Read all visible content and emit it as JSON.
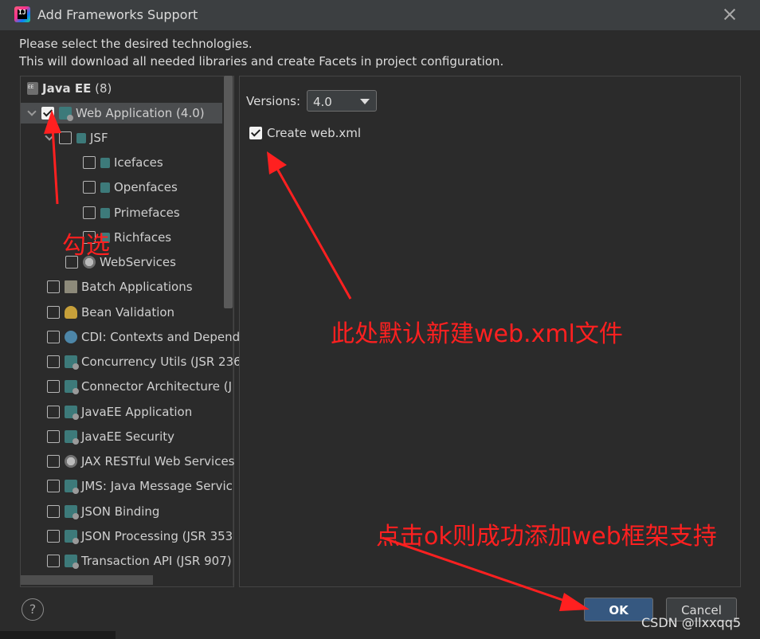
{
  "window": {
    "title": "Add Frameworks Support",
    "app_icon_text": "IJ",
    "description_line1": "Please select the desired technologies.",
    "description_line2": "This will download all needed libraries and create Facets in project configuration."
  },
  "tree": {
    "group_label": "Java EE",
    "group_count": "(8)",
    "items": [
      {
        "label": "Web Application (4.0)",
        "checked": true,
        "icon": "web-app-icon"
      },
      {
        "label": "JSF",
        "checked": false,
        "icon": "jsf-icon"
      },
      {
        "label": "Icefaces",
        "checked": false,
        "icon": "jsf-icon"
      },
      {
        "label": "Openfaces",
        "checked": false,
        "icon": "jsf-icon"
      },
      {
        "label": "Primefaces",
        "checked": false,
        "icon": "jsf-icon"
      },
      {
        "label": "Richfaces",
        "checked": false,
        "icon": "jsf-icon"
      },
      {
        "label": "WebServices",
        "checked": false,
        "icon": "globe-icon"
      },
      {
        "label": "Batch Applications",
        "checked": false,
        "icon": "folder-icon"
      },
      {
        "label": "Bean Validation",
        "checked": false,
        "icon": "bean-icon"
      },
      {
        "label": "CDI: Contexts and Depend",
        "checked": false,
        "icon": "cdi-icon"
      },
      {
        "label": "Concurrency Utils (JSR 236",
        "checked": false,
        "icon": "web-app-icon"
      },
      {
        "label": "Connector Architecture (J",
        "checked": false,
        "icon": "web-app-icon"
      },
      {
        "label": "JavaEE Application",
        "checked": false,
        "icon": "web-app-icon"
      },
      {
        "label": "JavaEE Security",
        "checked": false,
        "icon": "web-app-icon"
      },
      {
        "label": "JAX RESTful Web Services",
        "checked": false,
        "icon": "globe-icon"
      },
      {
        "label": "JMS: Java Message Servic",
        "checked": false,
        "icon": "web-app-icon"
      },
      {
        "label": "JSON Binding",
        "checked": false,
        "icon": "web-app-icon"
      },
      {
        "label": "JSON Processing (JSR 353",
        "checked": false,
        "icon": "web-app-icon"
      },
      {
        "label": "Transaction API (JSR 907)",
        "checked": false,
        "icon": "web-app-icon"
      }
    ]
  },
  "settings": {
    "versions_label": "Versions:",
    "version_value": "4.0",
    "create_web_xml_label": "Create web.xml",
    "create_web_xml_checked": true
  },
  "buttons": {
    "help": "?",
    "ok": "OK",
    "cancel": "Cancel"
  },
  "annotations": {
    "check_note": "勾选",
    "default_note": "此处默认新建web.xml文件",
    "ok_note": "点击ok则成功添加web框架支持",
    "color": "#ff2020"
  },
  "watermark": "CSDN @llxxqq5"
}
